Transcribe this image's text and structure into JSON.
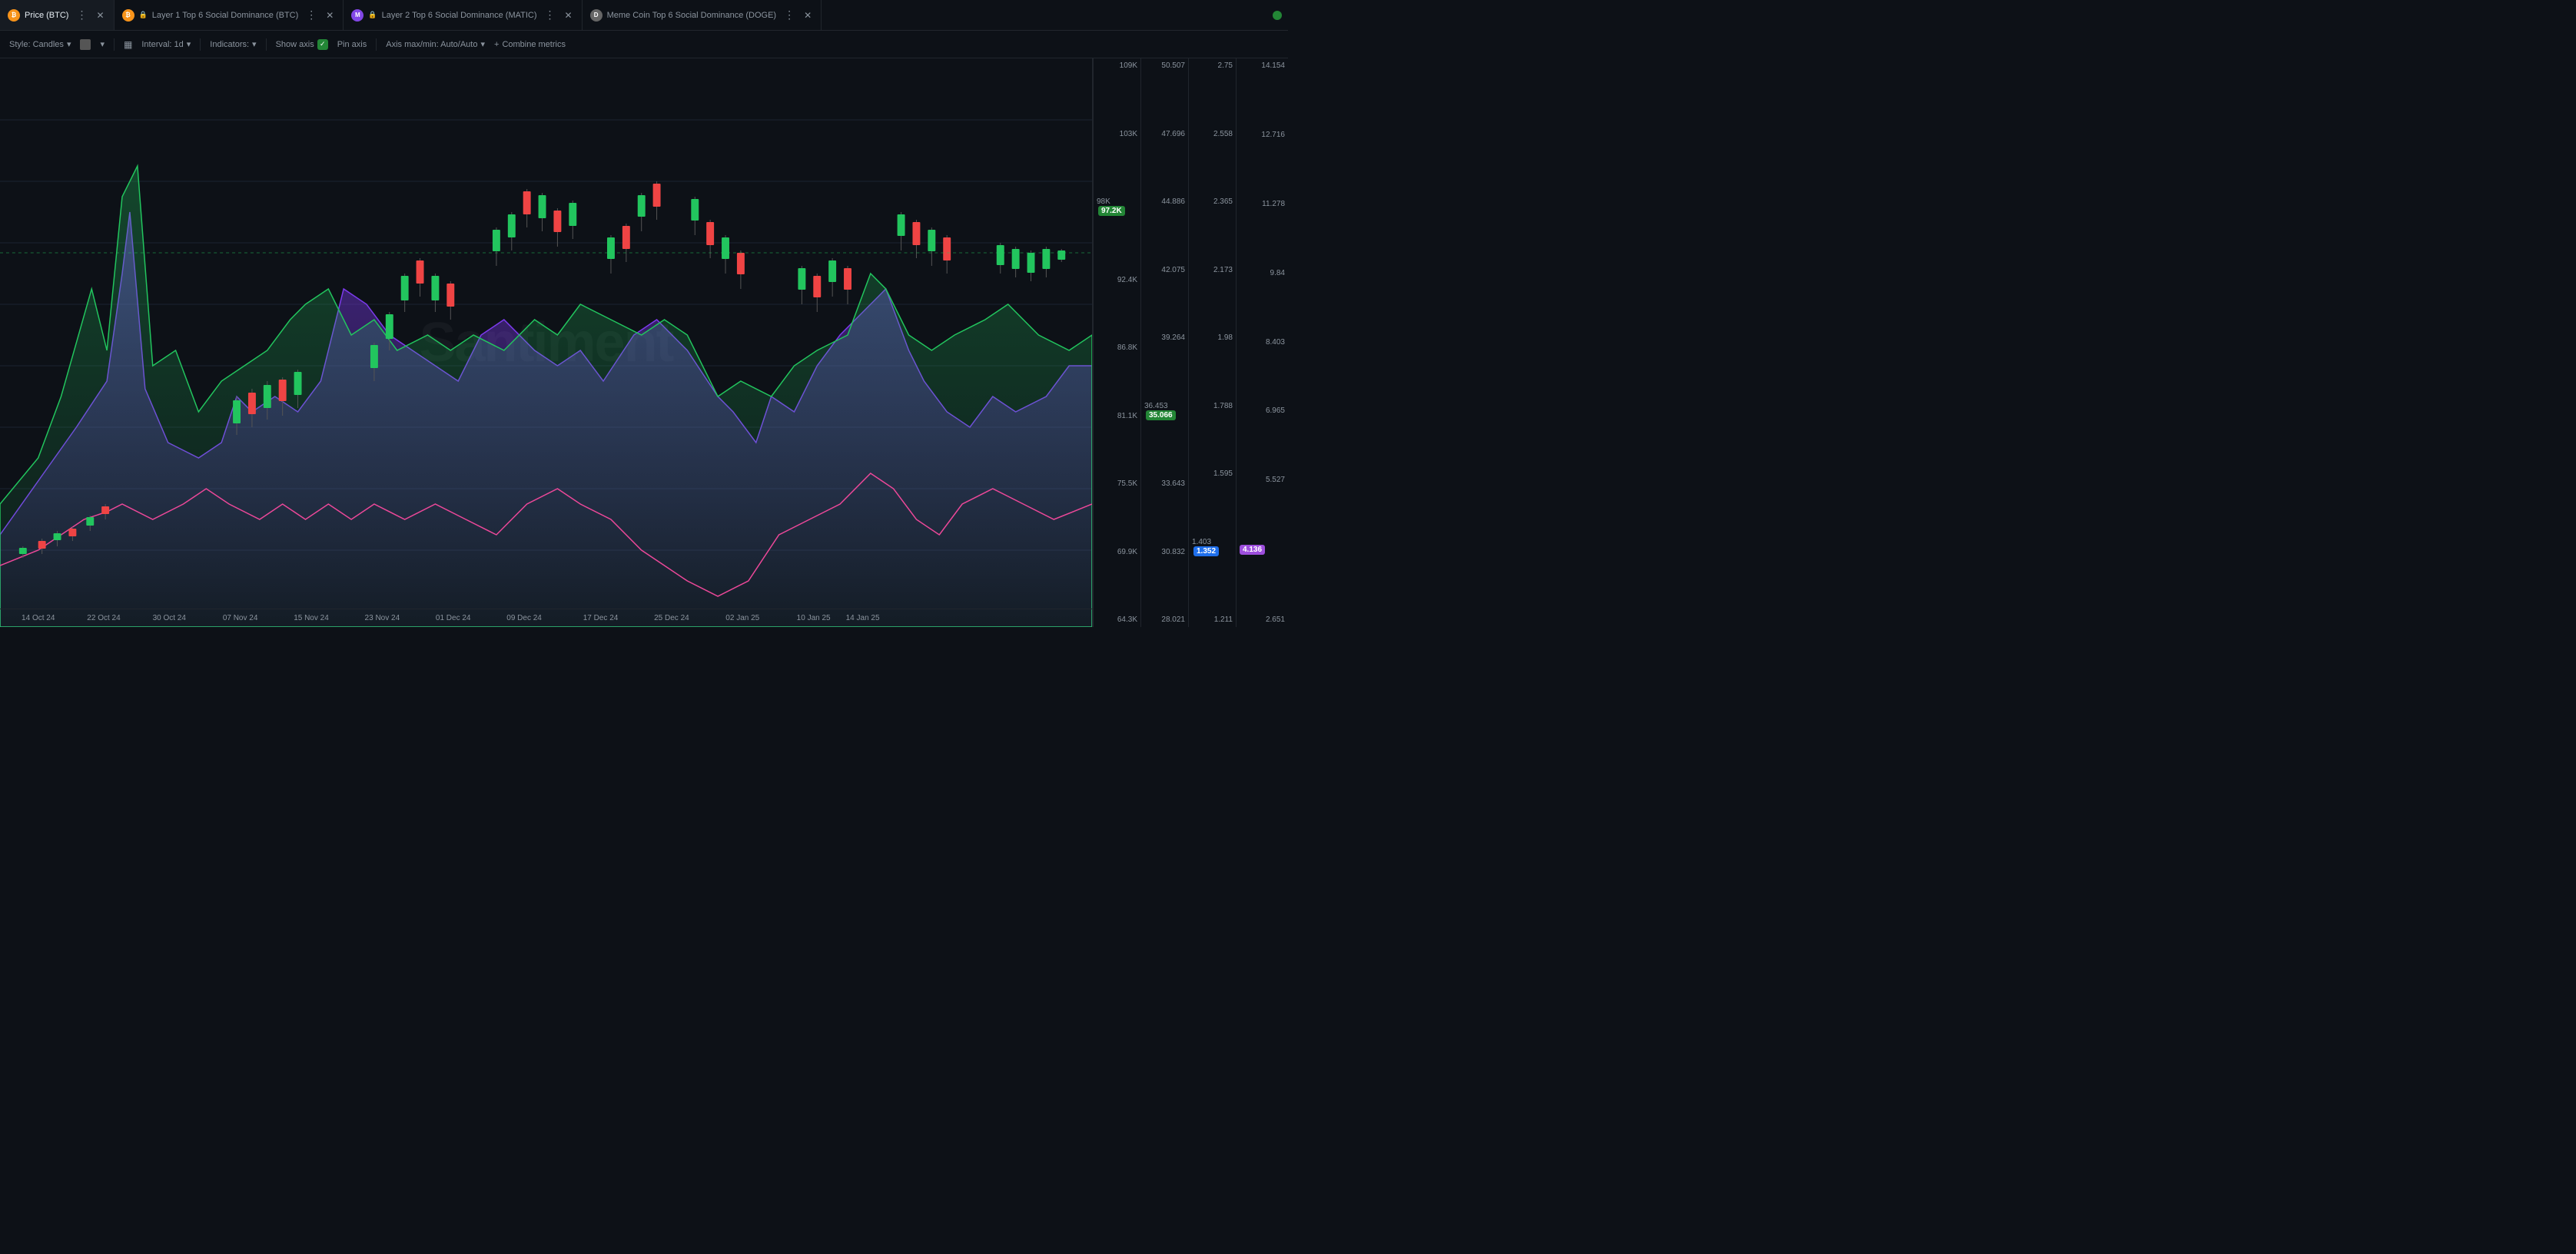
{
  "tabs": [
    {
      "id": "btc-price",
      "label": "Price (BTC)",
      "icon": "₿",
      "icon_color": "#f7931a",
      "active": true,
      "locked": false
    },
    {
      "id": "layer1",
      "label": "Layer 1 Top 6 Social Dominance (BTC)",
      "icon": "₿",
      "icon_color": "#f7931a",
      "active": false,
      "locked": true
    },
    {
      "id": "layer2",
      "label": "Layer 2 Top 6 Social Dominance (MATIC)",
      "icon": "M",
      "icon_color": "#8247e5",
      "active": false,
      "locked": true
    },
    {
      "id": "meme",
      "label": "Meme Coin Top 6 Social Dominance (DOGE)",
      "icon": "D",
      "icon_color": "#c3a634",
      "active": false,
      "locked": false
    }
  ],
  "toolbar": {
    "style_label": "Style: Candles",
    "interval_label": "Interval: 1d",
    "indicators_label": "Indicators:",
    "show_axis_label": "Show axis",
    "pin_axis_label": "Pin axis",
    "axis_minmax_label": "Axis max/min: Auto/Auto",
    "combine_label": "Combine metrics"
  },
  "watermark": "Santiment",
  "y_axis": {
    "col1": {
      "values": [
        "109K",
        "103K",
        "98K",
        "92.4K",
        "86.8K",
        "81.1K",
        "75.5K",
        "69.9K",
        "64.3K"
      ],
      "badge": {
        "value": "97.2K",
        "type": "green",
        "pct": 20
      }
    },
    "col2": {
      "values": [
        "50.507",
        "47.696",
        "44.886",
        "42.075",
        "39.264",
        "36.453",
        "33.643",
        "30.832",
        "28.021"
      ],
      "badge": {
        "value": "35.066",
        "type": "green",
        "pct": 73
      }
    },
    "col3": {
      "values": [
        "2.75",
        "2.558",
        "2.365",
        "2.173",
        "1.98",
        "1.788",
        "1.595",
        "1.403",
        "1.211"
      ],
      "badge": {
        "value": "1.352",
        "type": "blue",
        "pct": 87
      }
    },
    "col4": {
      "values": [
        "14.154",
        "12.716",
        "11.278",
        "9.84",
        "8.403",
        "6.965",
        "5.527",
        "",
        "2.651"
      ],
      "badge": {
        "value": "4.136",
        "type": "pink",
        "pct": 78
      }
    }
  },
  "x_axis": {
    "labels": [
      "14 Oct 24",
      "22 Oct 24",
      "30 Oct 24",
      "07 Nov 24",
      "15 Nov 24",
      "23 Nov 24",
      "01 Dec 24",
      "09 Dec 24",
      "17 Dec 24",
      "25 Dec 24",
      "02 Jan 25",
      "10 Jan 25",
      "14 Jan 25"
    ],
    "positions": [
      3.5,
      9.5,
      15.5,
      22,
      28.5,
      35,
      41.5,
      48,
      55,
      61.5,
      68,
      74.5,
      79
    ]
  }
}
